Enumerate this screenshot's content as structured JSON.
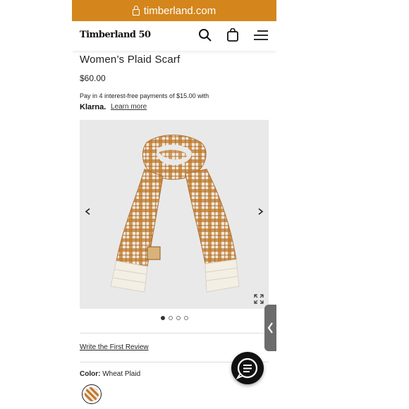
{
  "browser": {
    "url": "timberland.com"
  },
  "header": {
    "logo": "Timberland 50",
    "icons": [
      "search-icon",
      "bag-icon",
      "menu-icon"
    ]
  },
  "product": {
    "title": "Women’s Plaid Scarf",
    "price": "$60.00",
    "installments_text": "Pay in 4 interest-free payments of $15.00 with",
    "klarna_label": "Klarna.",
    "learn_more": "Learn more",
    "gallery": {
      "total_images": 4,
      "active_index": 0
    },
    "review_link": "Write the First Review",
    "color_label": "Color:",
    "color_value": "Wheat Plaid"
  },
  "colors": {
    "accent": "#d4861c",
    "scarf_rust": "#c07a2c",
    "scarf_cream": "#f1e8dc"
  }
}
